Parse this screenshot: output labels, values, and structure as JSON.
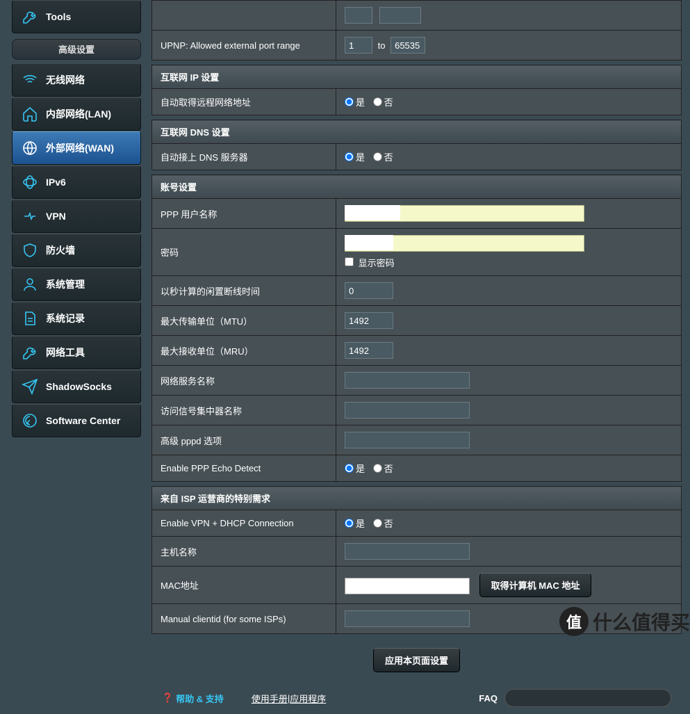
{
  "sidebar": {
    "tools": "Tools",
    "advanced_header": "高级设置",
    "items": [
      {
        "label": "无线网络",
        "icon": "wifi"
      },
      {
        "label": "内部网络(LAN)",
        "icon": "home"
      },
      {
        "label": "外部网络(WAN)",
        "icon": "globe",
        "active": true
      },
      {
        "label": "IPv6",
        "icon": "ipv6"
      },
      {
        "label": "VPN",
        "icon": "vpn"
      },
      {
        "label": "防火墙",
        "icon": "shield"
      },
      {
        "label": "系统管理",
        "icon": "user"
      },
      {
        "label": "系统记录",
        "icon": "log"
      },
      {
        "label": "网络工具",
        "icon": "wrench"
      },
      {
        "label": "ShadowSocks",
        "icon": "plane"
      },
      {
        "label": "Software Center",
        "icon": "software"
      }
    ]
  },
  "upnp": {
    "label": "UPNP: Allowed external port range",
    "from": "1",
    "to_label": "to",
    "to": "65535"
  },
  "sections": {
    "ip": {
      "title": "互联网 IP 设置",
      "auto_remote_addr": {
        "label": "自动取得远程网络地址",
        "yes": "是",
        "no": "否"
      }
    },
    "dns": {
      "title": "互联网 DNS 设置",
      "auto_dns": {
        "label": "自动接上 DNS 服务器",
        "yes": "是",
        "no": "否"
      }
    },
    "account": {
      "title": "账号设置",
      "ppp_user": {
        "label": "PPP 用户名称",
        "value": ""
      },
      "password": {
        "label": "密码",
        "value": "",
        "show_label": "显示密码"
      },
      "idle_disconnect": {
        "label": "以秒计算的闲置断线时间",
        "value": "0"
      },
      "mtu": {
        "label": "最大传输单位（MTU）",
        "value": "1492"
      },
      "mru": {
        "label": "最大接收单位（MRU）",
        "value": "1492"
      },
      "service_name": {
        "label": "网络服务名称",
        "value": ""
      },
      "concentrator": {
        "label": "访问信号集中器名称",
        "value": ""
      },
      "pppd_opts": {
        "label": "高级 pppd 选项",
        "value": ""
      },
      "ppp_echo": {
        "label": "Enable PPP Echo Detect",
        "yes": "是",
        "no": "否"
      }
    },
    "isp": {
      "title": "来自 ISP 运营商的特别需求",
      "vpn_dhcp": {
        "label": "Enable VPN + DHCP Connection",
        "yes": "是",
        "no": "否"
      },
      "hostname": {
        "label": "主机名称",
        "value": ""
      },
      "mac": {
        "label": "MAC地址",
        "value": "",
        "button": "取得计算机 MAC 地址"
      },
      "clientid": {
        "label": "Manual clientid (for some ISPs)",
        "value": ""
      }
    }
  },
  "apply_button": "应用本页面设置",
  "footer": {
    "help": "帮助 & 支持",
    "manual": "使用手册",
    "sep": " | ",
    "app": "应用程序",
    "faq": "FAQ"
  },
  "watermark": "什么值得买",
  "watermark_badge": "值"
}
